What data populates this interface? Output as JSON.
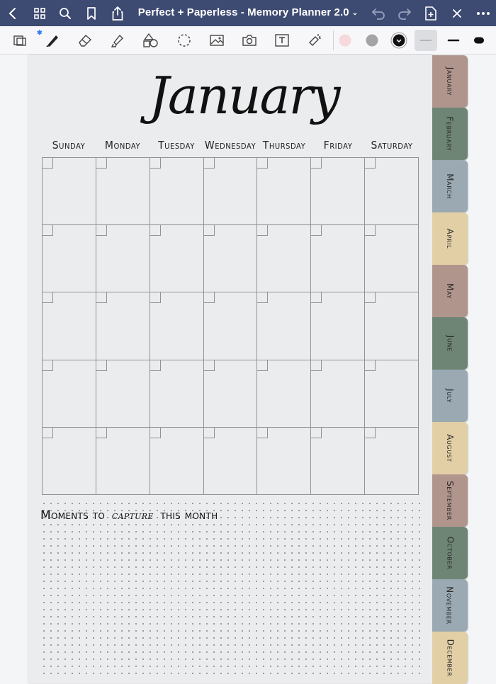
{
  "app": {
    "title": "Perfect + Paperless - Memory Planner 2.0",
    "title_chevron": "⌄"
  },
  "icons": {
    "back": "chevron-left-icon",
    "grid": "grid-icon",
    "search": "search-icon",
    "bookmark": "bookmark-icon",
    "share": "share-icon",
    "undo": "undo-icon",
    "redo": "redo-icon",
    "new_page": "new-page-icon",
    "close": "close-icon",
    "more": "more-icon"
  },
  "toolbar": {
    "tools": [
      "lasso-select-tool",
      "pen-tool",
      "eraser-tool",
      "highlighter-tool",
      "shapes-tool",
      "lasso-tool",
      "image-tool",
      "camera-tool",
      "text-tool",
      "laser-pointer-tool"
    ],
    "colors": {
      "swatch1": "#f6d9da",
      "swatch2": "#a3a4a6",
      "swatch3": "#111111"
    }
  },
  "planner": {
    "month": "January",
    "weekdays": [
      "Sunday",
      "Monday",
      "Tuesday",
      "Wednesday",
      "Thursday",
      "Friday",
      "Saturday"
    ],
    "moments": {
      "prefix": "Moments to",
      "script": "capture",
      "suffix": "this month"
    },
    "tabs": [
      {
        "label": "January",
        "color": "#b0958c"
      },
      {
        "label": "February",
        "color": "#6e8576"
      },
      {
        "label": "March",
        "color": "#9aa9b2"
      },
      {
        "label": "April",
        "color": "#e2cfa5"
      },
      {
        "label": "May",
        "color": "#b0958c"
      },
      {
        "label": "June",
        "color": "#6e8576"
      },
      {
        "label": "July",
        "color": "#9aa9b2"
      },
      {
        "label": "August",
        "color": "#e2cfa5"
      },
      {
        "label": "September",
        "color": "#b0958c"
      },
      {
        "label": "October",
        "color": "#6e8576"
      },
      {
        "label": "November",
        "color": "#9aa9b2"
      },
      {
        "label": "December",
        "color": "#e2cfa5"
      }
    ]
  },
  "colors": {
    "titlebar": "#3d4a72",
    "page": "#ebecee"
  }
}
